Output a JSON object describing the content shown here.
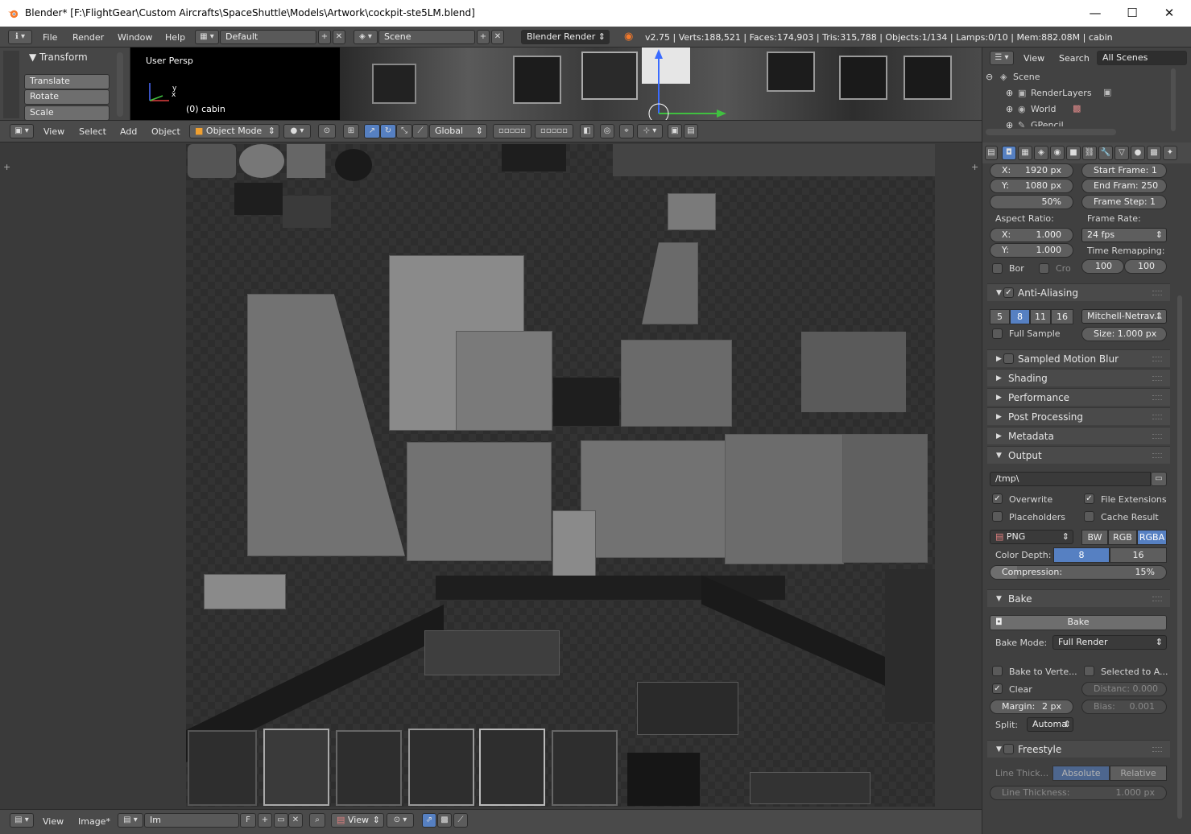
{
  "window": {
    "title": "Blender* [F:\\FlightGear\\Custom Aircrafts\\SpaceShuttle\\Models\\Artwork\\cockpit-ste5LM.blend]",
    "minimize": "—",
    "maximize": "☐",
    "close": "✕"
  },
  "infobar": {
    "menus": [
      "File",
      "Render",
      "Window",
      "Help"
    ],
    "layout": "Default",
    "scene": "Scene",
    "engine": "Blender Render",
    "stats": "v2.75 | Verts:188,521 | Faces:174,903 | Tris:315,788 | Objects:1/134 | Lamps:0/10 | Mem:882.08M | cabin"
  },
  "toolshelf": {
    "title": "Transform",
    "buttons": [
      "Translate",
      "Rotate",
      "Scale"
    ]
  },
  "viewport": {
    "view_name": "User Persp",
    "object_label": "(0) cabin",
    "axis_x": "x",
    "axis_y": "y",
    "header": {
      "menus": [
        "View",
        "Select",
        "Add",
        "Object"
      ],
      "mode": "Object Mode",
      "orientation": "Global"
    }
  },
  "image_editor": {
    "header": {
      "menus": [
        "View",
        "Image*"
      ],
      "image_name": "Im",
      "fake_user": "F",
      "view": "View"
    }
  },
  "outliner": {
    "menus": [
      "View",
      "Search"
    ],
    "filter": "All Scenes",
    "items": [
      {
        "label": "Scene",
        "icon": "scene-icon"
      },
      {
        "label": "RenderLayers",
        "icon": "renderlayers-icon"
      },
      {
        "label": "World",
        "icon": "world-icon"
      },
      {
        "label": "GPencil",
        "icon": "gpencil-icon"
      }
    ]
  },
  "properties": {
    "resolution": {
      "x_label": "X:",
      "x": "1920 px",
      "y_label": "Y:",
      "y": "1080 px",
      "percent": "50%"
    },
    "frames": {
      "start": "Start Frame: 1",
      "end": "End Fram: 250",
      "step": "Frame Step: 1"
    },
    "aspect": {
      "label": "Aspect Ratio:",
      "x_label": "X:",
      "x": "1.000",
      "y_label": "Y:",
      "y": "1.000"
    },
    "framerate": {
      "label": "Frame Rate:",
      "value": "24 fps",
      "remap_label": "Time Remapping:",
      "old": "100",
      "new": "100"
    },
    "border": "Bor",
    "crop": "Cro",
    "anti_aliasing": {
      "title": "Anti-Aliasing",
      "samples": [
        "5",
        "8",
        "11",
        "16"
      ],
      "selected_sample": "8",
      "filter": "Mitchell-Netrav...",
      "full_sample": "Full Sample",
      "size": "Size: 1.000 px"
    },
    "collapsed_sections": [
      "Sampled Motion Blur",
      "Shading",
      "Performance",
      "Post Processing",
      "Metadata"
    ],
    "output": {
      "title": "Output",
      "path": "/tmp\\",
      "overwrite": "Overwrite",
      "file_extensions": "File Extensions",
      "placeholders": "Placeholders",
      "cache_result": "Cache Result",
      "format": "PNG",
      "color_modes": [
        "BW",
        "RGB",
        "RGBA"
      ],
      "selected_color_mode": "RGBA",
      "color_depth_label": "Color Depth:",
      "depths": [
        "8",
        "16"
      ],
      "selected_depth": "8",
      "compression_label": "Compression:",
      "compression": "15%",
      "compression_fraction": 0.15
    },
    "bake": {
      "title": "Bake",
      "button": "Bake",
      "mode_label": "Bake Mode:",
      "mode": "Full Render",
      "to_vertex": "Bake to Verte...",
      "selected_to_active": "Selected to A...",
      "clear": "Clear",
      "distance": "Distanc: 0.000",
      "margin_label": "Margin:",
      "margin": "2 px",
      "bias_label": "Bias:",
      "bias": "0.001",
      "split_label": "Split:",
      "split": "Automa"
    },
    "freestyle": {
      "title": "Freestyle",
      "line_thickness_label": "Line Thick...",
      "modes": [
        "Absolute",
        "Relative"
      ],
      "selected_mode": "Absolute",
      "line_thickness": "Line Thickness:",
      "line_thickness_value": "1.000 px"
    }
  },
  "colors": {
    "accent": "#5680c2",
    "panel_bg": "#404040",
    "header_bg": "#4a4a4a"
  }
}
